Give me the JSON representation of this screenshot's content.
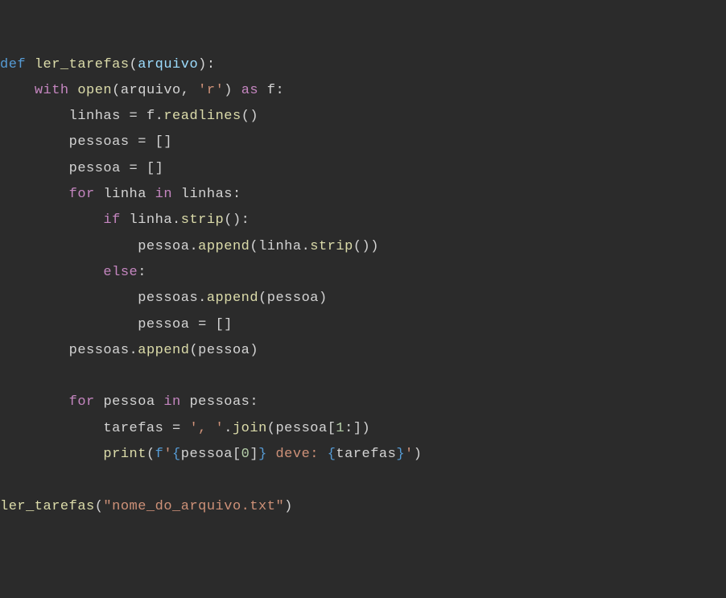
{
  "code": {
    "line1": {
      "def": "def",
      "fname": "ler_tarefas",
      "lparen": "(",
      "param": "arquivo",
      "rparen_colon": "):"
    },
    "line2": {
      "indent": "    ",
      "with": "with",
      "sp1": " ",
      "open": "open",
      "lparen": "(",
      "arg1": "arquivo",
      "comma_sp": ", ",
      "mode": "'r'",
      "rparen": ")",
      "sp2": " ",
      "as": "as",
      "sp3": " ",
      "fvar": "f",
      "colon": ":"
    },
    "line3": {
      "indent": "        ",
      "var": "linhas",
      "eq": " = ",
      "obj": "f",
      "dot": ".",
      "method": "readlines",
      "parens": "()"
    },
    "line4": {
      "indent": "        ",
      "var": "pessoas",
      "eq": " = ",
      "val": "[]"
    },
    "line5": {
      "indent": "        ",
      "var": "pessoa",
      "eq": " = ",
      "val": "[]"
    },
    "line6": {
      "indent": "        ",
      "for": "for",
      "sp1": " ",
      "itvar": "linha",
      "sp2": " ",
      "in": "in",
      "sp3": " ",
      "iter": "linhas",
      "colon": ":"
    },
    "line7": {
      "indent": "            ",
      "if": "if",
      "sp1": " ",
      "obj": "linha",
      "dot": ".",
      "method": "strip",
      "parens": "()",
      "colon": ":"
    },
    "line8": {
      "indent": "                ",
      "obj": "pessoa",
      "dot": ".",
      "method": "append",
      "lparen": "(",
      "arg_obj": "linha",
      "arg_dot": ".",
      "arg_method": "strip",
      "arg_parens": "()",
      "rparen": ")"
    },
    "line9": {
      "indent": "            ",
      "else": "else",
      "colon": ":"
    },
    "line10": {
      "indent": "                ",
      "obj": "pessoas",
      "dot": ".",
      "method": "append",
      "lparen": "(",
      "arg": "pessoa",
      "rparen": ")"
    },
    "line11": {
      "indent": "                ",
      "var": "pessoa",
      "eq": " = ",
      "val": "[]"
    },
    "line12": {
      "indent": "        ",
      "obj": "pessoas",
      "dot": ".",
      "method": "append",
      "lparen": "(",
      "arg": "pessoa",
      "rparen": ")"
    },
    "line14": {
      "indent": "        ",
      "for": "for",
      "sp1": " ",
      "itvar": "pessoa",
      "sp2": " ",
      "in": "in",
      "sp3": " ",
      "iter": "pessoas",
      "colon": ":"
    },
    "line15": {
      "indent": "            ",
      "var": "tarefas",
      "eq": " = ",
      "sep": "', '",
      "dot": ".",
      "method": "join",
      "lparen": "(",
      "arg_obj": "pessoa",
      "lbracket": "[",
      "idx": "1",
      "slice_colon": ":",
      "rbracket": "]",
      "rparen": ")"
    },
    "line16": {
      "indent": "            ",
      "print": "print",
      "lparen": "(",
      "fprefix": "f",
      "q1": "'",
      "lb1": "{",
      "expr_obj": "pessoa",
      "expr_lb": "[",
      "expr_idx": "0",
      "expr_rb": "]",
      "rb1": "}",
      "txt": " deve: ",
      "lb2": "{",
      "expr2": "tarefas",
      "rb2": "}",
      "q2": "'",
      "rparen": ")"
    },
    "line18": {
      "fname": "ler_tarefas",
      "lparen": "(",
      "arg": "\"nome_do_arquivo.txt\"",
      "rparen": ")"
    }
  }
}
